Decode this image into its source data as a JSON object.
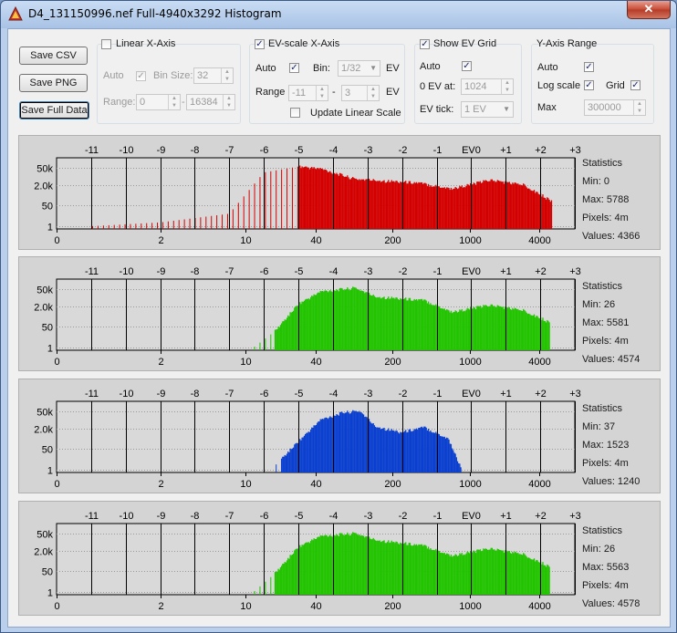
{
  "window": {
    "title": "D4_131150996.nef Full-4940x3292 Histogram",
    "close_glyph": "✕"
  },
  "buttons": {
    "save_csv": "Save CSV",
    "save_png": "Save PNG",
    "save_full": "Save Full Data"
  },
  "linear_x": {
    "label": "Linear X-Axis",
    "checked": false,
    "auto_label": "Auto",
    "auto_checked": true,
    "bin_size_label": "Bin Size:",
    "bin_size": "32",
    "range_label": "Range:",
    "range_min": "0",
    "range_max": "16384"
  },
  "ev_x": {
    "label": "EV-scale X-Axis",
    "checked": true,
    "auto_label": "Auto",
    "auto_checked": true,
    "bin_label": "Bin:",
    "bin": "1/32",
    "bin_unit": "EV",
    "range_label": "Range",
    "range_min": "-11",
    "range_sep": "-",
    "range_max": "3",
    "range_unit": "EV",
    "update_label": "Update Linear Scale",
    "update_checked": false
  },
  "ev_grid": {
    "label": "Show EV Grid",
    "checked": true,
    "auto_label": "Auto",
    "auto_checked": true,
    "zero_label": "0 EV at:",
    "zero_value": "1024",
    "tick_label": "EV tick:",
    "tick_value": "1 EV"
  },
  "y_axis": {
    "label": "Y-Axis Range",
    "auto_label": "Auto",
    "auto_checked": true,
    "log_label": "Log scale",
    "log_checked": true,
    "grid_label": "Grid",
    "grid_checked": true,
    "max_label": "Max",
    "max_value": "300000"
  },
  "axis": {
    "ev_ticks": [
      {
        "label": "-11",
        "value": 1
      },
      {
        "label": "-10",
        "value": 2
      },
      {
        "label": "-9",
        "value": 4
      },
      {
        "label": "-8",
        "value": 8
      },
      {
        "label": "-7",
        "value": 16
      },
      {
        "label": "-6",
        "value": 32
      },
      {
        "label": "-5",
        "value": 64
      },
      {
        "label": "-4",
        "value": 128
      },
      {
        "label": "-3",
        "value": 256
      },
      {
        "label": "-2",
        "value": 512
      },
      {
        "label": "-1",
        "value": 1024
      },
      {
        "label": "EV0",
        "value": 2048
      },
      {
        "label": "+1",
        "value": 4096
      },
      {
        "label": "+2",
        "value": 8192
      },
      {
        "label": "+3",
        "value": 16384
      }
    ],
    "x_ticks": [
      {
        "label": "0",
        "value": 0.5
      },
      {
        "label": "2",
        "value": 4
      },
      {
        "label": "10",
        "value": 22
      },
      {
        "label": "40",
        "value": 90
      },
      {
        "label": "200",
        "value": 420
      },
      {
        "label": "1000",
        "value": 2000
      },
      {
        "label": "4000",
        "value": 8000
      }
    ],
    "y_ticks": [
      {
        "label": "50k",
        "value": 50000
      },
      {
        "label": "2.0k",
        "value": 2000
      },
      {
        "label": "50",
        "value": 50
      },
      {
        "label": "1",
        "value": 1
      }
    ]
  },
  "chart_data": [
    {
      "type": "bar",
      "name": "red",
      "color": "#d40000",
      "stats_title": "Statistics",
      "min": "Min: 0",
      "max": "Max: 5788",
      "pixels": "Pixels: 4m",
      "values": "Values: 4366",
      "profile": [
        [
          1,
          1
        ],
        [
          4,
          2
        ],
        [
          16,
          10
        ],
        [
          32,
          20000
        ],
        [
          64,
          60000
        ],
        [
          100,
          40000
        ],
        [
          200,
          6000
        ],
        [
          700,
          3000
        ],
        [
          1400,
          1000
        ],
        [
          3000,
          5000
        ],
        [
          6000,
          2000
        ],
        [
          10400,
          100
        ]
      ],
      "sparse_below": 64
    },
    {
      "type": "bar",
      "name": "green",
      "color": "#22c400",
      "stats_title": "Statistics",
      "min": "Min: 26",
      "max": "Max: 5581",
      "pixels": "Pixels: 4m",
      "values": "Values: 4574",
      "profile": [
        [
          26,
          1
        ],
        [
          40,
          20
        ],
        [
          64,
          3000
        ],
        [
          100,
          30000
        ],
        [
          200,
          60000
        ],
        [
          300,
          12000
        ],
        [
          800,
          6000
        ],
        [
          1400,
          700
        ],
        [
          3000,
          2500
        ],
        [
          6000,
          900
        ],
        [
          10000,
          100
        ]
      ],
      "sparse_below": 40
    },
    {
      "type": "bar",
      "name": "blue",
      "color": "#0a3fd0",
      "stats_title": "Statistics",
      "min": "Min: 37",
      "max": "Max: 1523",
      "pixels": "Pixels: 4m",
      "values": "Values: 1240",
      "profile": [
        [
          37,
          1
        ],
        [
          60,
          100
        ],
        [
          100,
          10000
        ],
        [
          160,
          40000
        ],
        [
          220,
          50000
        ],
        [
          300,
          3000
        ],
        [
          500,
          1000
        ],
        [
          800,
          2500
        ],
        [
          1300,
          300
        ],
        [
          1700,
          1
        ]
      ],
      "sparse_below": 45
    },
    {
      "type": "bar",
      "name": "luminance",
      "color": "#22c400",
      "stats_title": "Statistics",
      "min": "Min: 26",
      "max": "Max: 5563",
      "pixels": "Pixels: 4m",
      "values": "Values: 4578",
      "profile": [
        [
          26,
          1
        ],
        [
          40,
          30
        ],
        [
          64,
          4000
        ],
        [
          100,
          30000
        ],
        [
          200,
          50000
        ],
        [
          300,
          15000
        ],
        [
          800,
          5000
        ],
        [
          1400,
          800
        ],
        [
          3000,
          3000
        ],
        [
          6000,
          1000
        ],
        [
          10000,
          100
        ]
      ],
      "sparse_below": 40
    }
  ]
}
